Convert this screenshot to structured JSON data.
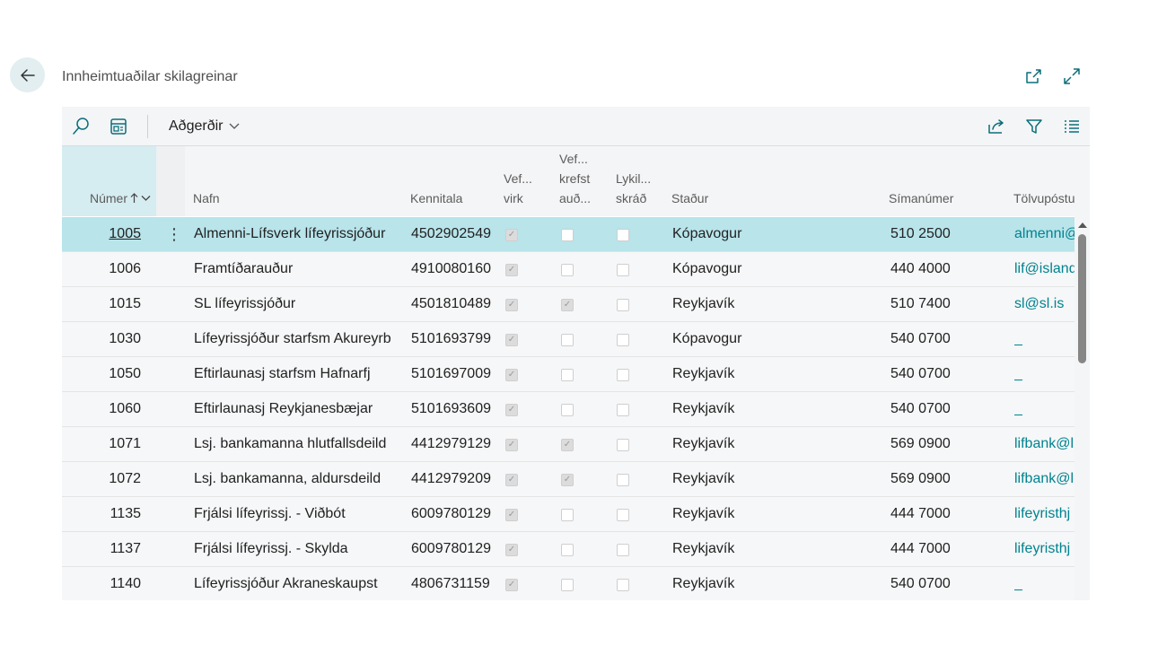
{
  "header": {
    "title": "Innheimtuaðilar skilagreinar",
    "back_icon": "arrow-left-icon",
    "open_new_window_icon": "open-in-new-window-icon",
    "expand_icon": "expand-icon"
  },
  "toolbar": {
    "actions_label": "Aðgerðir",
    "icons": [
      "search-icon",
      "layout-icon",
      "share-icon",
      "filter-icon",
      "list-view-icon"
    ]
  },
  "columns": {
    "numer": "Númer",
    "nafn": "Nafn",
    "kennitala": "Kennitala",
    "vef_virk_1": "Vef...",
    "vef_virk_2": "virk",
    "vef_krefst_1": "Vef...",
    "vef_krefst_2": "krefst",
    "vef_krefst_3": "auð...",
    "lykil_1": "Lykil...",
    "lykil_2": "skráð",
    "stadur": "Staður",
    "simanumer": "Símanúmer",
    "tolvupostur": "Tölvupóstur"
  },
  "colors": {
    "accent": "#00838f",
    "selected_row": "#b8e4ea",
    "sorted_header": "#d5ecf0"
  },
  "rows": [
    {
      "numer": "1005",
      "nafn": "Almenni-Lífsverk lífeyrissjóður",
      "kennitala": "4502902549",
      "vef_virk": true,
      "vef_krefst": false,
      "lykil": false,
      "stadur": "Kópavogur",
      "simi": "510 2500",
      "email": "almenni@"
    },
    {
      "numer": "1006",
      "nafn": "Framtíðarauður",
      "kennitala": "4910080160",
      "vef_virk": true,
      "vef_krefst": false,
      "lykil": false,
      "stadur": "Kópavogur",
      "simi": "440 4000",
      "email": "lif@island"
    },
    {
      "numer": "1015",
      "nafn": "SL lífeyrissjóður",
      "kennitala": "4501810489",
      "vef_virk": true,
      "vef_krefst": true,
      "lykil": false,
      "stadur": "Reykjavík",
      "simi": "510 7400",
      "email": "sl@sl.is"
    },
    {
      "numer": "1030",
      "nafn": "Lífeyrissjóður starfsm Akureyrb",
      "kennitala": "5101693799",
      "vef_virk": true,
      "vef_krefst": false,
      "lykil": false,
      "stadur": "Kópavogur",
      "simi": "540 0700",
      "email": "_"
    },
    {
      "numer": "1050",
      "nafn": "Eftirlaunasj starfsm Hafnarfj",
      "kennitala": "5101697009",
      "vef_virk": true,
      "vef_krefst": false,
      "lykil": false,
      "stadur": "Reykjavík",
      "simi": "540 0700",
      "email": "_"
    },
    {
      "numer": "1060",
      "nafn": "Eftirlaunasj Reykjanesbæjar",
      "kennitala": "5101693609",
      "vef_virk": true,
      "vef_krefst": false,
      "lykil": false,
      "stadur": "Reykjavík",
      "simi": "540 0700",
      "email": "_"
    },
    {
      "numer": "1071",
      "nafn": "Lsj. bankamanna hlutfallsdeild",
      "kennitala": "4412979129",
      "vef_virk": true,
      "vef_krefst": true,
      "lykil": false,
      "stadur": "Reykjavík",
      "simi": "569 0900",
      "email": "lifbank@l"
    },
    {
      "numer": "1072",
      "nafn": "Lsj. bankamanna, aldursdeild",
      "kennitala": "4412979209",
      "vef_virk": true,
      "vef_krefst": true,
      "lykil": false,
      "stadur": "Reykjavík",
      "simi": "569 0900",
      "email": "lifbank@l"
    },
    {
      "numer": "1135",
      "nafn": "Frjálsi lífeyrissj. - Viðbót",
      "kennitala": "6009780129",
      "vef_virk": true,
      "vef_krefst": false,
      "lykil": false,
      "stadur": "Reykjavík",
      "simi": "444 7000",
      "email": "lifeyristhj"
    },
    {
      "numer": "1137",
      "nafn": "Frjálsi lífeyrissj. - Skylda",
      "kennitala": "6009780129",
      "vef_virk": true,
      "vef_krefst": false,
      "lykil": false,
      "stadur": "Reykjavík",
      "simi": "444 7000",
      "email": "lifeyristhj"
    },
    {
      "numer": "1140",
      "nafn": "Lífeyrissjóður Akraneskaupst",
      "kennitala": "4806731159",
      "vef_virk": true,
      "vef_krefst": false,
      "lykil": false,
      "stadur": "Reykjavík",
      "simi": "540 0700",
      "email": "_"
    }
  ]
}
